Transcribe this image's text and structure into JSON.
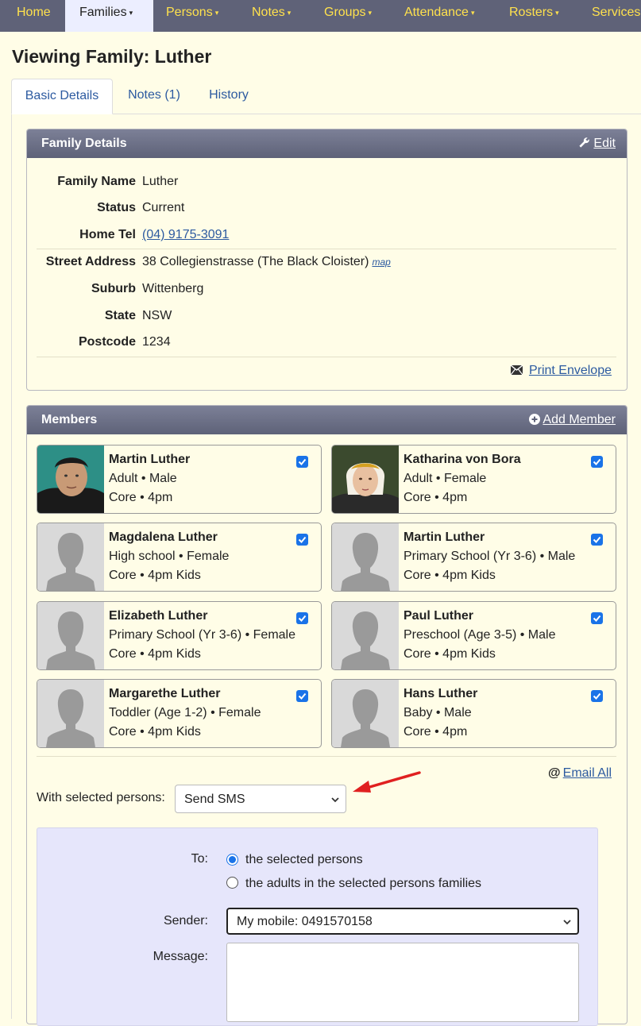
{
  "nav": {
    "items": [
      {
        "label": "Home",
        "caret": false
      },
      {
        "label": "Families",
        "caret": true
      },
      {
        "label": "Persons",
        "caret": true
      },
      {
        "label": "Notes",
        "caret": true
      },
      {
        "label": "Groups",
        "caret": true
      },
      {
        "label": "Attendance",
        "caret": true
      },
      {
        "label": "Rosters",
        "caret": true
      },
      {
        "label": "Services",
        "caret": false
      }
    ],
    "caret_glyph": "▾"
  },
  "page_title": "Viewing Family: Luther",
  "tabs": [
    "Basic Details",
    "Notes (1)",
    "History"
  ],
  "family_details": {
    "heading": "Family Details",
    "edit_label": "Edit",
    "rows": [
      {
        "label": "Family Name",
        "value": "Luther"
      },
      {
        "label": "Status",
        "value": "Current"
      },
      {
        "label": "Home Tel",
        "value": "(04) 9175-3091"
      },
      {
        "label": "Street Address",
        "value": "38 Collegienstrasse (The Black Cloister)",
        "extra": "map"
      },
      {
        "label": "Suburb",
        "value": "Wittenberg"
      },
      {
        "label": "State",
        "value": "NSW"
      },
      {
        "label": "Postcode",
        "value": "1234"
      }
    ],
    "print_envelope": "Print Envelope"
  },
  "members": {
    "heading": "Members",
    "add_member": "Add Member",
    "list": [
      {
        "name": "Martin Luther",
        "line1": "Adult • Male",
        "line2": "Core • 4pm",
        "checked": true,
        "photo": "portrait-martin"
      },
      {
        "name": "Katharina von Bora",
        "line1": "Adult • Female",
        "line2": "Core • 4pm",
        "checked": true,
        "photo": "portrait-katharina"
      },
      {
        "name": "Magdalena Luther",
        "line1": "High school • Female",
        "line2": "Core • 4pm Kids",
        "checked": true,
        "photo": "silhouette"
      },
      {
        "name": "Martin Luther",
        "line1": "Primary School (Yr 3-6) • Male",
        "line2": "Core • 4pm Kids",
        "checked": true,
        "photo": "silhouette"
      },
      {
        "name": "Elizabeth Luther",
        "line1": "Primary School (Yr 3-6) • Female",
        "line2": "Core • 4pm Kids",
        "checked": true,
        "photo": "silhouette"
      },
      {
        "name": "Paul Luther",
        "line1": "Preschool (Age 3-5) • Male",
        "line2": "Core • 4pm Kids",
        "checked": true,
        "photo": "silhouette"
      },
      {
        "name": "Margarethe Luther",
        "line1": "Toddler (Age 1-2) • Female",
        "line2": "Core • 4pm Kids",
        "checked": true,
        "photo": "silhouette"
      },
      {
        "name": "Hans Luther",
        "line1": "Baby • Male",
        "line2": "Core • 4pm",
        "checked": true,
        "photo": "silhouette"
      }
    ],
    "email_all": "Email All",
    "email_at": "@"
  },
  "bulk": {
    "label": "With selected persons:",
    "action": "Send SMS"
  },
  "sms": {
    "to_label": "To:",
    "to_options": [
      {
        "label": "the selected persons",
        "selected": true
      },
      {
        "label": "the adults in the selected persons families",
        "selected": false
      }
    ],
    "sender_label": "Sender:",
    "sender_value": "My mobile: 0491570158",
    "message_label": "Message:",
    "message_value": ""
  },
  "colors": {
    "navbar": "#5f6278",
    "nav_text": "#ffe14d",
    "page_bg": "#fffde7",
    "link": "#2c5aa0",
    "checkbox": "#1a73e8",
    "sms_panel": "#e6e6fb",
    "arrow": "#e02020"
  }
}
